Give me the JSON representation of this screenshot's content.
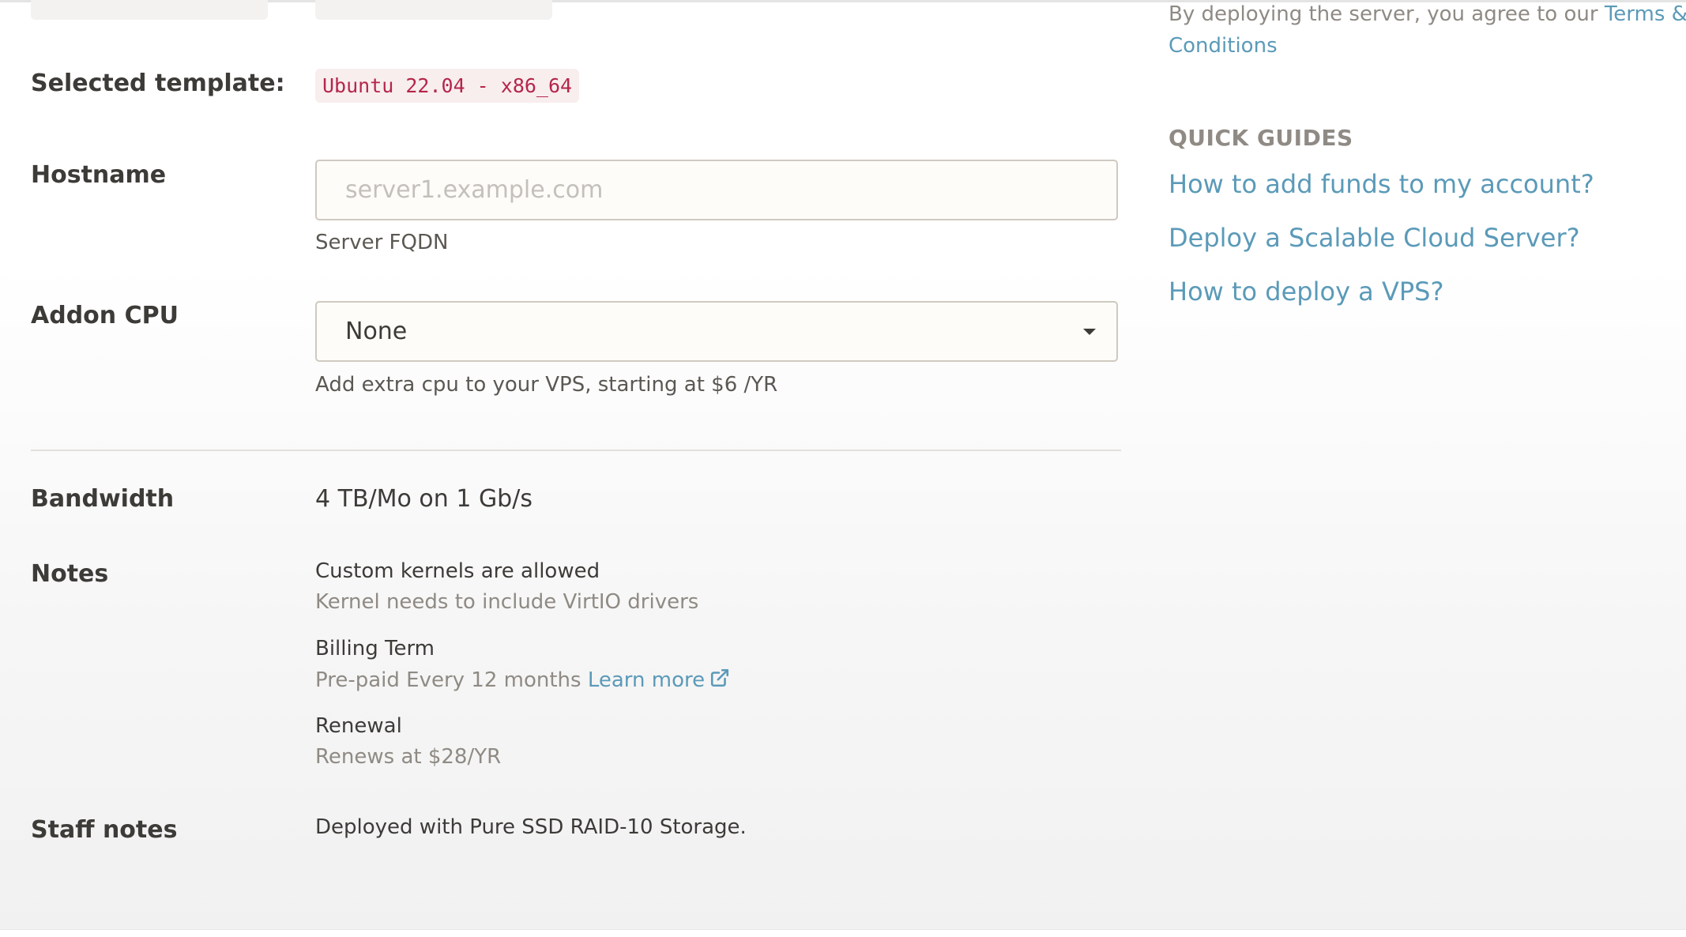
{
  "form": {
    "selected_template_label": "Selected template:",
    "selected_template_value": "Ubuntu 22.04 - x86_64",
    "hostname_label": "Hostname",
    "hostname_placeholder": "server1.example.com",
    "hostname_value": "",
    "hostname_help": "Server FQDN",
    "addon_cpu_label": "Addon CPU",
    "addon_cpu_selected": "None",
    "addon_cpu_help": "Add extra cpu to your VPS, starting at $6 /YR",
    "bandwidth_label": "Bandwidth",
    "bandwidth_value": "4 TB/Mo on 1 Gb/s",
    "notes_label": "Notes",
    "notes": [
      {
        "title": "Custom kernels are allowed",
        "sub": "Kernel needs to include VirtIO drivers"
      },
      {
        "title": "Billing Term",
        "sub": "Pre-paid Every 12 months",
        "link": "Learn more"
      },
      {
        "title": "Renewal",
        "sub": "Renews at $28/YR"
      }
    ],
    "staff_notes_label": "Staff notes",
    "staff_notes_value": "Deployed with Pure SSD RAID-10 Storage."
  },
  "sidebar": {
    "terms_prefix": "By deploying the server, you agree to our",
    "terms_link_line1": "Terms &",
    "terms_link_line2": "Conditions",
    "quick_guides_title": "QUICK GUIDES",
    "guides": [
      "How to add funds to my account?",
      "Deploy a Scalable Cloud Server?",
      "How to deploy a VPS?"
    ]
  },
  "colors": {
    "link": "#5b9ab8",
    "code": "#b5264a",
    "code_bg": "#f8eeee",
    "label": "#3d3b38",
    "muted": "#8f8a84"
  },
  "icons": {
    "select_caret": "caret-down-icon",
    "external_link": "external-link-icon"
  }
}
